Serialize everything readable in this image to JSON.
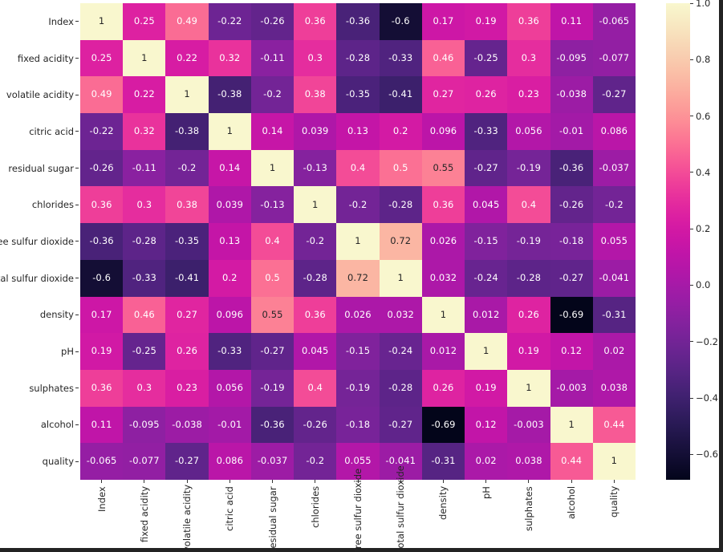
{
  "chart_data": {
    "type": "heatmap",
    "title": "",
    "xlabel": "",
    "ylabel": "",
    "colormap": "rocket",
    "colorbar": {
      "ticks": [
        "1.0",
        "0.8",
        "0.6",
        "0.4",
        "0.2",
        "0.0",
        "−0.2",
        "−0.4",
        "−0.6"
      ],
      "tick_values": [
        1.0,
        0.8,
        0.6,
        0.4,
        0.2,
        0.0,
        -0.2,
        -0.4,
        -0.6
      ],
      "vmin": -0.69,
      "vmax": 1.0,
      "position": "right"
    },
    "grid": false,
    "annotated": true,
    "categories": [
      "Index",
      "fixed acidity",
      "volatile acidity",
      "citric acid",
      "residual sugar",
      "chlorides",
      "free sulfur dioxide",
      "total sulfur dioxide",
      "density",
      "pH",
      "sulphates",
      "alcohol",
      "quality"
    ],
    "xticklabels": [
      "Index",
      "fixed acidity",
      "volatile acidity",
      "citric acid",
      "residual sugar",
      "chlorides",
      "free sulfur dioxide",
      "total sulfur dioxide",
      "density",
      "pH",
      "sulphates",
      "alcohol",
      "quality"
    ],
    "yticklabels": [
      "Index",
      "fixed acidity",
      "volatile acidity",
      "citric acid",
      "residual sugar",
      "chlorides",
      "free sulfur dioxide",
      "total sulfur dioxide",
      "density",
      "pH",
      "sulphates",
      "alcohol",
      "quality"
    ],
    "values": [
      [
        1,
        0.25,
        0.49,
        -0.22,
        -0.26,
        0.36,
        -0.36,
        -0.6,
        0.17,
        0.19,
        0.36,
        0.11,
        -0.065
      ],
      [
        0.25,
        1,
        0.22,
        0.32,
        -0.11,
        0.3,
        -0.28,
        -0.33,
        0.46,
        -0.25,
        0.3,
        -0.095,
        -0.077
      ],
      [
        0.49,
        0.22,
        1,
        -0.38,
        -0.2,
        0.38,
        -0.35,
        -0.41,
        0.27,
        0.26,
        0.23,
        -0.038,
        -0.27
      ],
      [
        -0.22,
        0.32,
        -0.38,
        1,
        0.14,
        0.039,
        0.13,
        0.2,
        0.096,
        -0.33,
        0.056,
        -0.01,
        0.086
      ],
      [
        -0.26,
        -0.11,
        -0.2,
        0.14,
        1,
        -0.13,
        0.4,
        0.5,
        0.55,
        -0.27,
        -0.19,
        -0.36,
        -0.037
      ],
      [
        0.36,
        0.3,
        0.38,
        0.039,
        -0.13,
        1,
        -0.2,
        -0.28,
        0.36,
        0.045,
        0.4,
        -0.26,
        -0.2
      ],
      [
        -0.36,
        -0.28,
        -0.35,
        0.13,
        0.4,
        -0.2,
        1,
        0.72,
        0.026,
        -0.15,
        -0.19,
        -0.18,
        0.055
      ],
      [
        -0.6,
        -0.33,
        -0.41,
        0.2,
        0.5,
        -0.28,
        0.72,
        1,
        0.032,
        -0.24,
        -0.28,
        -0.27,
        -0.041
      ],
      [
        0.17,
        0.46,
        0.27,
        0.096,
        0.55,
        0.36,
        0.026,
        0.032,
        1,
        0.012,
        0.26,
        -0.69,
        -0.31
      ],
      [
        0.19,
        -0.25,
        0.26,
        -0.33,
        -0.27,
        0.045,
        -0.15,
        -0.24,
        0.012,
        1,
        0.19,
        0.12,
        0.02
      ],
      [
        0.36,
        0.3,
        0.23,
        0.056,
        -0.19,
        0.4,
        -0.19,
        -0.28,
        0.26,
        0.19,
        1,
        -0.003,
        0.038
      ],
      [
        0.11,
        -0.095,
        -0.038,
        -0.01,
        -0.36,
        -0.26,
        -0.18,
        -0.27,
        -0.69,
        0.12,
        -0.003,
        1,
        0.44
      ],
      [
        -0.065,
        -0.077,
        -0.27,
        0.086,
        -0.037,
        -0.2,
        0.055,
        -0.041,
        -0.31,
        0.02,
        0.038,
        0.44,
        1
      ]
    ],
    "labels": [
      [
        "1",
        "0.25",
        "0.49",
        "-0.22",
        "-0.26",
        "0.36",
        "-0.36",
        "-0.6",
        "0.17",
        "0.19",
        "0.36",
        "0.11",
        "-0.065"
      ],
      [
        "0.25",
        "1",
        "0.22",
        "0.32",
        "-0.11",
        "0.3",
        "-0.28",
        "-0.33",
        "0.46",
        "-0.25",
        "0.3",
        "-0.095",
        "-0.077"
      ],
      [
        "0.49",
        "0.22",
        "1",
        "-0.38",
        "-0.2",
        "0.38",
        "-0.35",
        "-0.41",
        "0.27",
        "0.26",
        "0.23",
        "-0.038",
        "-0.27"
      ],
      [
        "-0.22",
        "0.32",
        "-0.38",
        "1",
        "0.14",
        "0.039",
        "0.13",
        "0.2",
        "0.096",
        "-0.33",
        "0.056",
        "-0.01",
        "0.086"
      ],
      [
        "-0.26",
        "-0.11",
        "-0.2",
        "0.14",
        "1",
        "-0.13",
        "0.4",
        "0.5",
        "0.55",
        "-0.27",
        "-0.19",
        "-0.36",
        "-0.037"
      ],
      [
        "0.36",
        "0.3",
        "0.38",
        "0.039",
        "-0.13",
        "1",
        "-0.2",
        "-0.28",
        "0.36",
        "0.045",
        "0.4",
        "-0.26",
        "-0.2"
      ],
      [
        "-0.36",
        "-0.28",
        "-0.35",
        "0.13",
        "0.4",
        "-0.2",
        "1",
        "0.72",
        "0.026",
        "-0.15",
        "-0.19",
        "-0.18",
        "0.055"
      ],
      [
        "-0.6",
        "-0.33",
        "-0.41",
        "0.2",
        "0.5",
        "-0.28",
        "0.72",
        "1",
        "0.032",
        "-0.24",
        "-0.28",
        "-0.27",
        "-0.041"
      ],
      [
        "0.17",
        "0.46",
        "0.27",
        "0.096",
        "0.55",
        "0.36",
        "0.026",
        "0.032",
        "1",
        "0.012",
        "0.26",
        "-0.69",
        "-0.31"
      ],
      [
        "0.19",
        "-0.25",
        "0.26",
        "-0.33",
        "-0.27",
        "0.045",
        "-0.15",
        "-0.24",
        "0.012",
        "1",
        "0.19",
        "0.12",
        "0.02"
      ],
      [
        "0.36",
        "0.3",
        "0.23",
        "0.056",
        "-0.19",
        "0.4",
        "-0.19",
        "-0.28",
        "0.26",
        "0.19",
        "1",
        "-0.003",
        "0.038"
      ],
      [
        "0.11",
        "-0.095",
        "-0.038",
        "-0.01",
        "-0.36",
        "-0.26",
        "-0.18",
        "-0.27",
        "-0.69",
        "0.12",
        "-0.003",
        "1",
        "0.44"
      ],
      [
        "-0.065",
        "-0.077",
        "-0.27",
        "0.086",
        "-0.037",
        "-0.2",
        "0.055",
        "-0.041",
        "-0.31",
        "0.02",
        "0.038",
        "0.44",
        "1"
      ]
    ]
  }
}
